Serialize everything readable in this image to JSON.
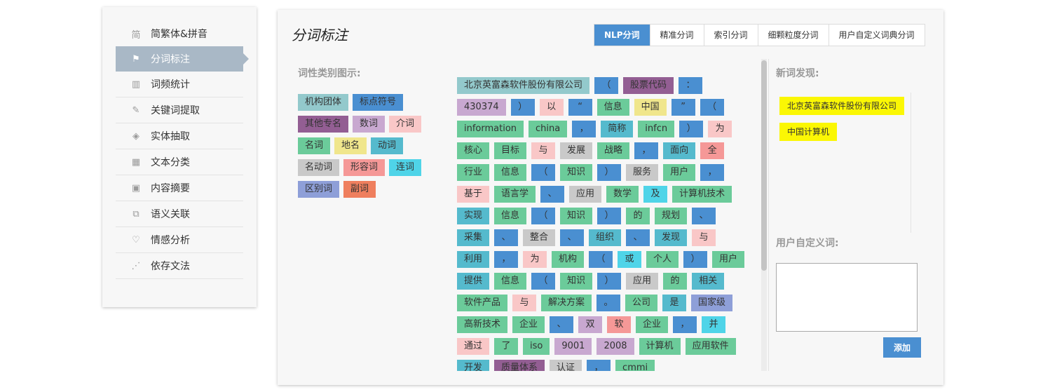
{
  "sidebar": {
    "items": [
      {
        "label": "简繁体&拼音",
        "icon": "simplified-traditional-icon",
        "icon_glyph": "简",
        "name": "sidebar-item-simplified-pinyin"
      },
      {
        "label": "分词标注",
        "icon": "flag-icon",
        "icon_glyph": "⚑",
        "name": "sidebar-item-segmentation",
        "active": true
      },
      {
        "label": "词频统计",
        "icon": "bar-chart-icon",
        "icon_glyph": "▥",
        "name": "sidebar-item-word-frequency"
      },
      {
        "label": "关键词提取",
        "icon": "keyword-icon",
        "icon_glyph": "✎",
        "name": "sidebar-item-keyword-extraction"
      },
      {
        "label": "实体抽取",
        "icon": "entity-icon",
        "icon_glyph": "◈",
        "name": "sidebar-item-entity-extraction"
      },
      {
        "label": "文本分类",
        "icon": "grid-icon",
        "icon_glyph": "▦",
        "name": "sidebar-item-text-classification"
      },
      {
        "label": "内容摘要",
        "icon": "summary-icon",
        "icon_glyph": "▣",
        "name": "sidebar-item-summary"
      },
      {
        "label": "语义关联",
        "icon": "link-icon",
        "icon_glyph": "⧉",
        "name": "sidebar-item-semantic-association"
      },
      {
        "label": "情感分析",
        "icon": "heart-icon",
        "icon_glyph": "♡",
        "name": "sidebar-item-sentiment-analysis"
      },
      {
        "label": "依存文法",
        "icon": "dependency-icon",
        "icon_glyph": "⋰",
        "name": "sidebar-item-dependency-grammar"
      }
    ]
  },
  "main": {
    "title": "分词标注",
    "tabs": [
      "NLP分词",
      "精准分词",
      "索引分词",
      "细颗粒度分词",
      "用户自定义词典分词"
    ],
    "active_tab": 0,
    "legend_title": "词性类别图示:",
    "new_words_title": "新词发现:",
    "user_dict_title": "用户自定义词:",
    "add_button": "添加"
  },
  "colors": {
    "org": "#93c9cc",
    "punct": "#4a8fd1",
    "other_proper": "#935e93",
    "numeral": "#c8a8d0",
    "prep": "#f9c7c7",
    "noun": "#6bcb9a",
    "place": "#f0e68c",
    "verb": "#55bacd",
    "gerund": "#c9c9c9",
    "adj": "#f59897",
    "conj": "#4fd4e8",
    "distinguish": "#8e9fd8",
    "adverb": "#ef7f5e",
    "accent": "#4a8fd1",
    "new_word": "#fbf704"
  },
  "legend": [
    [
      {
        "label": "机构团体",
        "type": "org"
      },
      {
        "label": "标点符号",
        "type": "punct"
      }
    ],
    [
      {
        "label": "其他专名",
        "type": "other_proper"
      },
      {
        "label": "数词",
        "type": "numeral"
      },
      {
        "label": "介词",
        "type": "prep"
      }
    ],
    [
      {
        "label": "名词",
        "type": "noun"
      },
      {
        "label": "地名",
        "type": "place"
      },
      {
        "label": "动词",
        "type": "verb"
      }
    ],
    [
      {
        "label": "名动词",
        "type": "gerund"
      },
      {
        "label": "形容词",
        "type": "adj"
      },
      {
        "label": "连词",
        "type": "conj"
      }
    ],
    [
      {
        "label": "区别词",
        "type": "distinguish"
      },
      {
        "label": "副词",
        "type": "adverb"
      }
    ]
  ],
  "tokens": [
    {
      "t": "北京英富森软件股份有限公司",
      "c": "org"
    },
    {
      "t": "（",
      "c": "punct"
    },
    {
      "t": "股票代码",
      "c": "other_proper"
    },
    {
      "t": "：",
      "c": "punct"
    },
    {
      "t": "430374",
      "c": "numeral"
    },
    {
      "t": "）",
      "c": "punct"
    },
    {
      "t": "以",
      "c": "prep"
    },
    {
      "t": "“",
      "c": "punct"
    },
    {
      "t": "信息",
      "c": "noun"
    },
    {
      "t": "中国",
      "c": "place"
    },
    {
      "t": "”",
      "c": "punct"
    },
    {
      "t": "（",
      "c": "punct"
    },
    {
      "t": "information",
      "c": "noun"
    },
    {
      "t": "china",
      "c": "noun"
    },
    {
      "t": "，",
      "c": "punct"
    },
    {
      "t": "简称",
      "c": "verb"
    },
    {
      "t": "infcn",
      "c": "noun"
    },
    {
      "t": "）",
      "c": "punct"
    },
    {
      "t": "为",
      "c": "prep"
    },
    {
      "t": "核心",
      "c": "noun"
    },
    {
      "t": "目标",
      "c": "noun"
    },
    {
      "t": "与",
      "c": "prep"
    },
    {
      "t": "发展",
      "c": "gerund"
    },
    {
      "t": "战略",
      "c": "noun"
    },
    {
      "t": "，",
      "c": "punct"
    },
    {
      "t": "面向",
      "c": "verb"
    },
    {
      "t": "全",
      "c": "adj"
    },
    {
      "t": "行业",
      "c": "noun"
    },
    {
      "t": "信息",
      "c": "noun"
    },
    {
      "t": "（",
      "c": "punct"
    },
    {
      "t": "知识",
      "c": "noun"
    },
    {
      "t": "）",
      "c": "punct"
    },
    {
      "t": "服务",
      "c": "gerund"
    },
    {
      "t": "用户",
      "c": "noun"
    },
    {
      "t": "，",
      "c": "punct"
    },
    {
      "t": "基于",
      "c": "prep"
    },
    {
      "t": "语言学",
      "c": "noun"
    },
    {
      "t": "、",
      "c": "punct"
    },
    {
      "t": "应用",
      "c": "gerund"
    },
    {
      "t": "数学",
      "c": "noun"
    },
    {
      "t": "及",
      "c": "conj"
    },
    {
      "t": "计算机技术",
      "c": "noun"
    },
    {
      "t": "实现",
      "c": "verb"
    },
    {
      "t": "信息",
      "c": "noun"
    },
    {
      "t": "（",
      "c": "punct"
    },
    {
      "t": "知识",
      "c": "noun"
    },
    {
      "t": "）",
      "c": "punct"
    },
    {
      "t": "的",
      "c": "noun"
    },
    {
      "t": "规划",
      "c": "noun"
    },
    {
      "t": "、",
      "c": "punct"
    },
    {
      "t": "采集",
      "c": "verb"
    },
    {
      "t": "、",
      "c": "punct"
    },
    {
      "t": "整合",
      "c": "gerund"
    },
    {
      "t": "、",
      "c": "punct"
    },
    {
      "t": "组织",
      "c": "verb"
    },
    {
      "t": "、",
      "c": "punct"
    },
    {
      "t": "发现",
      "c": "verb"
    },
    {
      "t": "与",
      "c": "prep"
    },
    {
      "t": "利用",
      "c": "verb"
    },
    {
      "t": "，",
      "c": "punct"
    },
    {
      "t": "为",
      "c": "prep"
    },
    {
      "t": "机构",
      "c": "noun"
    },
    {
      "t": "（",
      "c": "punct"
    },
    {
      "t": "或",
      "c": "conj"
    },
    {
      "t": "个人",
      "c": "noun"
    },
    {
      "t": "）",
      "c": "punct"
    },
    {
      "t": "用户",
      "c": "noun"
    },
    {
      "t": "提供",
      "c": "verb"
    },
    {
      "t": "信息",
      "c": "noun"
    },
    {
      "t": "（",
      "c": "punct"
    },
    {
      "t": "知识",
      "c": "noun"
    },
    {
      "t": "）",
      "c": "punct"
    },
    {
      "t": "应用",
      "c": "gerund"
    },
    {
      "t": "的",
      "c": "noun"
    },
    {
      "t": "相关",
      "c": "verb"
    },
    {
      "t": "软件产品",
      "c": "noun"
    },
    {
      "t": "与",
      "c": "prep"
    },
    {
      "t": "解决方案",
      "c": "noun"
    },
    {
      "t": "。",
      "c": "punct"
    },
    {
      "t": "公司",
      "c": "noun"
    },
    {
      "t": "是",
      "c": "verb"
    },
    {
      "t": "国家级",
      "c": "distinguish"
    },
    {
      "t": "高新技术",
      "c": "noun"
    },
    {
      "t": "企业",
      "c": "noun"
    },
    {
      "t": "、",
      "c": "punct"
    },
    {
      "t": "双",
      "c": "numeral"
    },
    {
      "t": "软",
      "c": "adj"
    },
    {
      "t": "企业",
      "c": "noun"
    },
    {
      "t": "，",
      "c": "punct"
    },
    {
      "t": "并",
      "c": "conj"
    },
    {
      "t": "通过",
      "c": "prep"
    },
    {
      "t": "了",
      "c": "noun"
    },
    {
      "t": "iso",
      "c": "noun"
    },
    {
      "t": "9001",
      "c": "numeral"
    },
    {
      "t": "2008",
      "c": "numeral"
    },
    {
      "t": "计算机",
      "c": "noun"
    },
    {
      "t": "应用软件",
      "c": "noun"
    },
    {
      "t": "开发",
      "c": "verb"
    },
    {
      "t": "质量体系",
      "c": "other_proper"
    },
    {
      "t": "认证",
      "c": "gerund"
    },
    {
      "t": "，",
      "c": "punct"
    },
    {
      "t": "cmmi",
      "c": "noun"
    }
  ],
  "new_words": [
    "北京英富森软件股份有限公司",
    "中国计算机"
  ]
}
